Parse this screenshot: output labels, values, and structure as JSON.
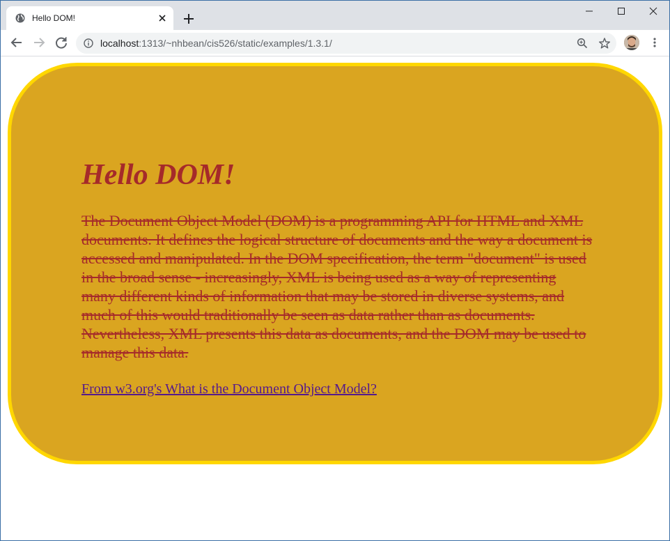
{
  "browser": {
    "tab": {
      "title": "Hello DOM!"
    },
    "address": {
      "host": "localhost",
      "path": ":1313/~nhbean/cis526/static/examples/1.3.1/"
    },
    "icons": {
      "favicon": "globe-icon",
      "tab_close": "close-icon",
      "new_tab": "plus-icon",
      "back": "arrow-left-icon",
      "forward": "arrow-right-icon",
      "reload": "reload-icon",
      "site_info": "info-icon",
      "zoom": "zoom-icon",
      "bookmark": "star-icon",
      "menu": "kebab-menu-icon"
    }
  },
  "page": {
    "heading": "Hello DOM!",
    "paragraph": "The Document Object Model (DOM) is a programming API for HTML and XML documents. It defines the logical structure of documents and the way a document is accessed and manipulated. In the DOM specification, the term \"document\" is used in the broad sense - increasingly, XML is being used as a way of representing many different kinds of information that may be stored in diverse systems, and much of this would traditionally be seen as data rather than as documents. Nevertheless, XML presents this data as documents, and the DOM may be used to manage this data.",
    "link_text": "From w3.org's What is the Document Object Model?"
  },
  "colors": {
    "card_background": "#daa520",
    "card_border": "#ffd700",
    "text": "#a52a2a",
    "link": "#551a8b"
  }
}
